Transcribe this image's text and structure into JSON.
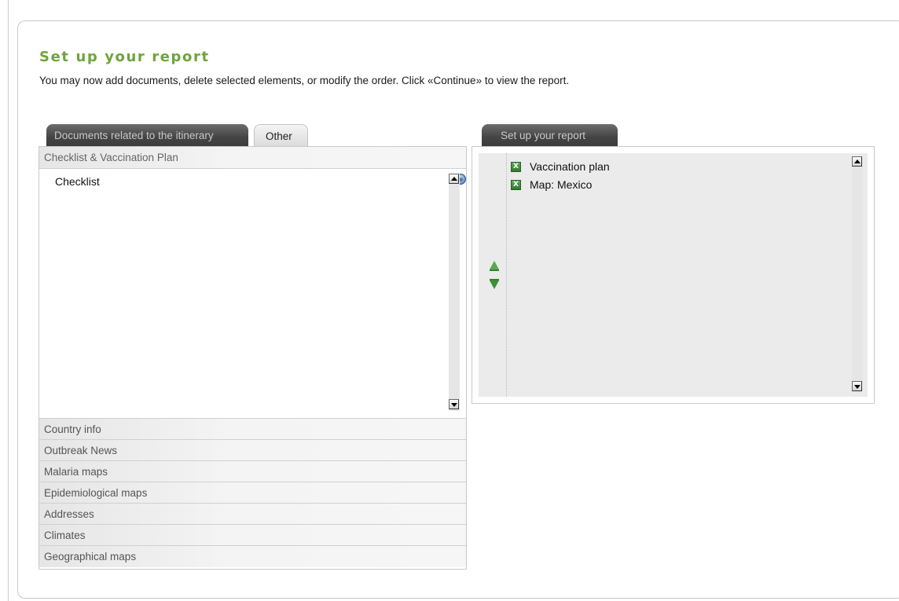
{
  "page": {
    "title": "Set up your report",
    "intro": "You may now add documents, delete selected elements, or modify the order. Click «Continue» to view the report."
  },
  "left_tabs": [
    {
      "label": "Documents related to the itinerary",
      "state": "inactive"
    },
    {
      "label": "Other",
      "state": "active"
    }
  ],
  "right_tab": {
    "label": "Set up your report"
  },
  "categories": [
    {
      "label": "Checklist & Vaccination Plan",
      "expanded": true
    },
    {
      "label": "Country info"
    },
    {
      "label": "Outbreak News"
    },
    {
      "label": "Malaria maps"
    },
    {
      "label": "Epidemiological maps"
    },
    {
      "label": "Addresses"
    },
    {
      "label": "Climates"
    },
    {
      "label": "Geographical maps"
    }
  ],
  "expanded_items": [
    {
      "label": "Checklist",
      "icon": "globe-icon"
    }
  ],
  "report_items": [
    {
      "label": "Vaccination plan",
      "icon": "excel-icon"
    },
    {
      "label": "Map: Mexico",
      "icon": "excel-icon"
    }
  ],
  "colors": {
    "title": "#6fa43a",
    "tab_dark": "#444444",
    "arrow_green": "#4a9c45"
  }
}
